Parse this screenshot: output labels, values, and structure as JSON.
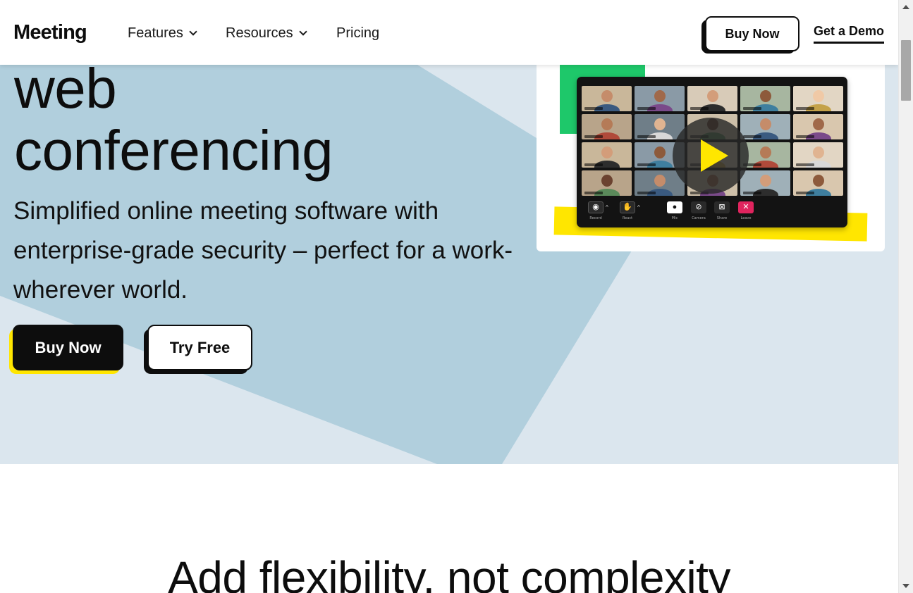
{
  "header": {
    "logo": "Meeting",
    "nav": [
      {
        "label": "Features",
        "has_dropdown": true
      },
      {
        "label": "Resources",
        "has_dropdown": true
      },
      {
        "label": "Pricing",
        "has_dropdown": false
      }
    ],
    "buy_now": "Buy Now",
    "get_demo": "Get a Demo"
  },
  "hero": {
    "headline_line1": "web",
    "headline_line2": "conferencing",
    "subhead": "Simplified online meeting software with enterprise-grade security – perfect for a work-wherever world.",
    "primary_cta": "Buy Now",
    "secondary_cta": "Try Free"
  },
  "video": {
    "toolbar": [
      {
        "label": "Record",
        "icon": "eye-icon"
      },
      {
        "label": "React",
        "icon": "hand-icon"
      },
      {
        "label": "Mic",
        "icon": "mic-icon"
      },
      {
        "label": "Camera",
        "icon": "camera-off-icon"
      },
      {
        "label": "Share",
        "icon": "share-off-icon"
      },
      {
        "label": "Leave",
        "icon": "close-icon"
      }
    ]
  },
  "section": {
    "title": "Add flexibility, not complexity"
  },
  "colors": {
    "accent_yellow": "#ffe600",
    "accent_green": "#1ec86a",
    "hero_bg": "#dbe6ee",
    "hero_shape": "#b1cfdd",
    "ink": "#0d0d0d",
    "leave_red": "#e0245e"
  }
}
